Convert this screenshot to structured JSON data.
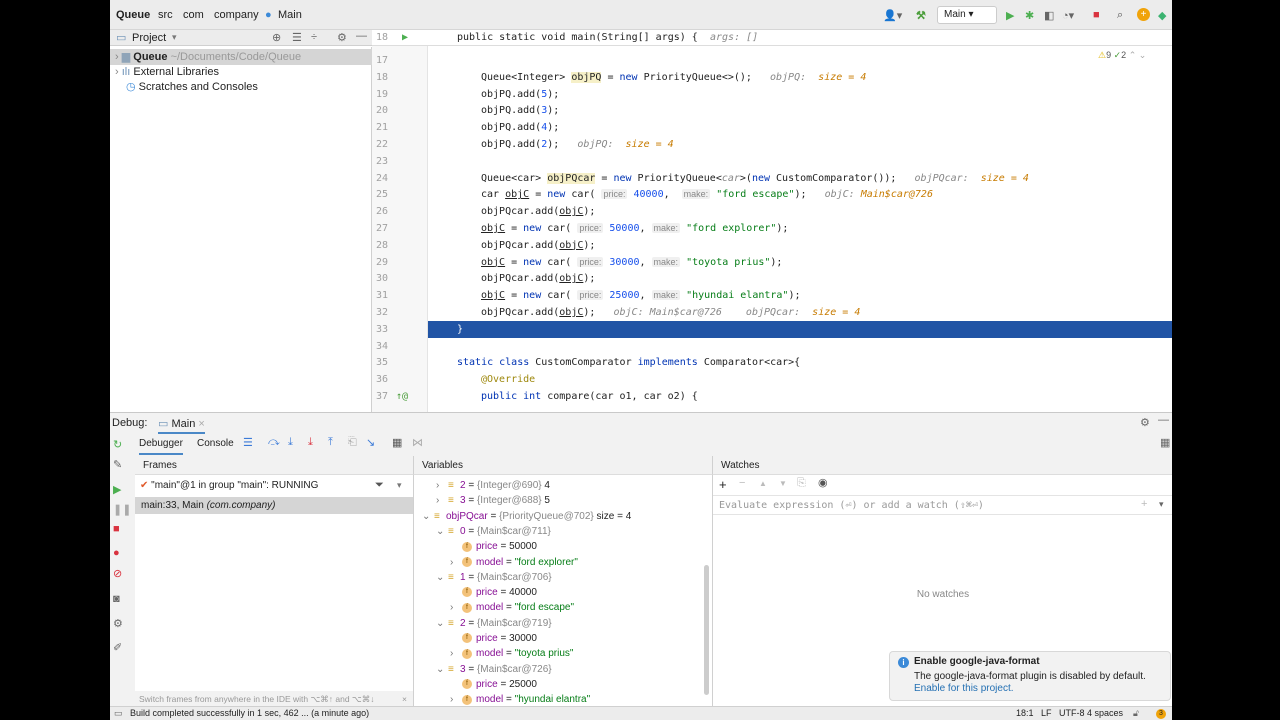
{
  "breadcrumb": [
    "Queue",
    "src",
    "com",
    "company",
    "Main"
  ],
  "nav": {
    "run_config": "Main"
  },
  "project": {
    "label": "Project",
    "items": [
      {
        "name": "Queue",
        "path": "~/Documents/Code/Queue"
      },
      {
        "name": "External Libraries"
      },
      {
        "name": "Scratches and Consoles"
      }
    ]
  },
  "editor": {
    "sticky": {
      "n": "18",
      "text": "public static void main(String[] args) {",
      "hint": "args: []"
    },
    "warnings": "9",
    "weak_warnings": "2",
    "lines": [
      {
        "n": "17",
        "i": 0,
        "t": []
      },
      {
        "n": "18",
        "i": 2,
        "t": [
          [
            "Queue<Integer> ",
            ""
          ],
          [
            "objPQ",
            "hl"
          ],
          [
            " = ",
            ""
          ],
          [
            "new",
            "kw"
          ],
          [
            " PriorityQueue<>();   ",
            ""
          ],
          [
            "objPQ:  ",
            "hint"
          ],
          [
            "size = 4",
            "hintv"
          ]
        ]
      },
      {
        "n": "19",
        "i": 2,
        "t": [
          [
            "objPQ.add(",
            ""
          ],
          [
            "5",
            "num"
          ],
          [
            ");",
            ""
          ]
        ]
      },
      {
        "n": "20",
        "i": 2,
        "t": [
          [
            "objPQ.add(",
            ""
          ],
          [
            "3",
            "num"
          ],
          [
            ");",
            ""
          ]
        ]
      },
      {
        "n": "21",
        "i": 2,
        "t": [
          [
            "objPQ.add(",
            ""
          ],
          [
            "4",
            "num"
          ],
          [
            ");",
            ""
          ]
        ]
      },
      {
        "n": "22",
        "i": 2,
        "t": [
          [
            "objPQ.add(",
            ""
          ],
          [
            "2",
            "num"
          ],
          [
            ");   ",
            ""
          ],
          [
            "objPQ:  ",
            "hint"
          ],
          [
            "size = 4",
            "hintv"
          ]
        ]
      },
      {
        "n": "23",
        "i": 0,
        "t": []
      },
      {
        "n": "24",
        "i": 2,
        "t": [
          [
            "Queue<car> ",
            ""
          ],
          [
            "objPQcar",
            "hl"
          ],
          [
            " = ",
            ""
          ],
          [
            "new",
            "kw"
          ],
          [
            " PriorityQueue<",
            ""
          ],
          [
            "car",
            "hint"
          ],
          [
            ">(",
            ""
          ],
          [
            "new",
            "kw"
          ],
          [
            " CustomComparator());   ",
            ""
          ],
          [
            "objPQcar:  ",
            "hint"
          ],
          [
            "size = 4",
            "hintv"
          ]
        ]
      },
      {
        "n": "25",
        "i": 2,
        "t": [
          [
            "car ",
            ""
          ],
          [
            "objC",
            "ul"
          ],
          [
            " = ",
            ""
          ],
          [
            "new",
            "kw"
          ],
          [
            " car( ",
            ""
          ],
          [
            "price:",
            "param"
          ],
          [
            " ",
            ""
          ],
          [
            "40000",
            "num"
          ],
          [
            ",  ",
            ""
          ],
          [
            "make:",
            "param"
          ],
          [
            " ",
            ""
          ],
          [
            "\"ford escape\"",
            "str"
          ],
          [
            ");   ",
            ""
          ],
          [
            "objC: ",
            "hint"
          ],
          [
            "Main$car@726",
            "hintv"
          ]
        ]
      },
      {
        "n": "26",
        "i": 2,
        "t": [
          [
            "objPQcar.add(",
            ""
          ],
          [
            "objC",
            "ul"
          ],
          [
            ");",
            ""
          ]
        ]
      },
      {
        "n": "27",
        "i": 2,
        "t": [
          [
            "objC",
            "ul"
          ],
          [
            " = ",
            ""
          ],
          [
            "new",
            "kw"
          ],
          [
            " car( ",
            ""
          ],
          [
            "price:",
            "param"
          ],
          [
            " ",
            ""
          ],
          [
            "50000",
            "num"
          ],
          [
            ", ",
            ""
          ],
          [
            "make:",
            "param"
          ],
          [
            " ",
            ""
          ],
          [
            "\"ford explorer\"",
            "str"
          ],
          [
            ");",
            ""
          ]
        ]
      },
      {
        "n": "28",
        "i": 2,
        "t": [
          [
            "objPQcar.add(",
            ""
          ],
          [
            "objC",
            "ul"
          ],
          [
            ");",
            ""
          ]
        ]
      },
      {
        "n": "29",
        "i": 2,
        "t": [
          [
            "objC",
            "ul"
          ],
          [
            " = ",
            ""
          ],
          [
            "new",
            "kw"
          ],
          [
            " car( ",
            ""
          ],
          [
            "price:",
            "param"
          ],
          [
            " ",
            ""
          ],
          [
            "30000",
            "num"
          ],
          [
            ", ",
            ""
          ],
          [
            "make:",
            "param"
          ],
          [
            " ",
            ""
          ],
          [
            "\"toyota prius\"",
            "str"
          ],
          [
            ");",
            ""
          ]
        ]
      },
      {
        "n": "30",
        "i": 2,
        "t": [
          [
            "objPQcar.add(",
            ""
          ],
          [
            "objC",
            "ul"
          ],
          [
            ");",
            ""
          ]
        ]
      },
      {
        "n": "31",
        "i": 2,
        "t": [
          [
            "objC",
            "ul"
          ],
          [
            " = ",
            ""
          ],
          [
            "new",
            "kw"
          ],
          [
            " car( ",
            ""
          ],
          [
            "price:",
            "param"
          ],
          [
            " ",
            ""
          ],
          [
            "25000",
            "num"
          ],
          [
            ", ",
            ""
          ],
          [
            "make:",
            "param"
          ],
          [
            " ",
            ""
          ],
          [
            "\"hyundai elantra\"",
            "str"
          ],
          [
            ");",
            ""
          ]
        ]
      },
      {
        "n": "32",
        "i": 2,
        "t": [
          [
            "objPQcar.add(",
            ""
          ],
          [
            "objC",
            "ul"
          ],
          [
            ");   ",
            ""
          ],
          [
            "objC: Main$car@726    objPQcar:  ",
            "hint"
          ],
          [
            "size = 4",
            "hintv"
          ]
        ]
      },
      {
        "n": "33",
        "i": 1,
        "t": [
          [
            "}",
            ""
          ]
        ],
        "current": true
      },
      {
        "n": "34",
        "i": 0,
        "t": []
      },
      {
        "n": "35",
        "i": 1,
        "t": [
          [
            "static class",
            "kw"
          ],
          [
            " CustomComparator ",
            ""
          ],
          [
            "implements",
            "kw"
          ],
          [
            " Comparator<car>{",
            ""
          ]
        ]
      },
      {
        "n": "36",
        "i": 2,
        "t": [
          [
            "@Override",
            "ann"
          ]
        ]
      },
      {
        "n": "37",
        "i": 2,
        "t": [
          [
            "public int",
            "kw"
          ],
          [
            " compare(car o1, car o2) {",
            ""
          ]
        ]
      }
    ]
  },
  "debug": {
    "label": "Debug:",
    "session": "Main",
    "tabs": [
      "Debugger",
      "Console"
    ],
    "frames": {
      "title": "Frames",
      "thread": "\"main\"@1 in group \"main\": RUNNING",
      "frame": "main:33, Main",
      "frame_pkg": "(com.company)",
      "tip": "Switch frames from anywhere in the IDE with ⌥⌘↑ and ⌥⌘↓"
    },
    "variables": {
      "title": "Variables",
      "rows": [
        {
          "d": 1,
          "e": ">",
          "k": "list",
          "n": "2",
          "v": "{Integer@690}",
          "x": "4"
        },
        {
          "d": 1,
          "e": ">",
          "k": "list",
          "n": "3",
          "v": "{Integer@688}",
          "x": "5"
        },
        {
          "d": 0,
          "e": "v",
          "k": "list",
          "n": "objPQcar",
          "v": "{PriorityQueue@702}",
          "x": " size = 4"
        },
        {
          "d": 1,
          "e": "v",
          "k": "list",
          "n": "0",
          "v": "{Main$car@711}",
          "x": ""
        },
        {
          "d": 2,
          "e": "",
          "k": "f",
          "n": "price",
          "v": "",
          "x": "50000"
        },
        {
          "d": 2,
          "e": ">",
          "k": "f",
          "n": "model",
          "v": "",
          "x": "\"ford explorer\"",
          "s": true
        },
        {
          "d": 1,
          "e": "v",
          "k": "list",
          "n": "1",
          "v": "{Main$car@706}",
          "x": ""
        },
        {
          "d": 2,
          "e": "",
          "k": "f",
          "n": "price",
          "v": "",
          "x": "40000"
        },
        {
          "d": 2,
          "e": ">",
          "k": "f",
          "n": "model",
          "v": "",
          "x": "\"ford escape\"",
          "s": true
        },
        {
          "d": 1,
          "e": "v",
          "k": "list",
          "n": "2",
          "v": "{Main$car@719}",
          "x": ""
        },
        {
          "d": 2,
          "e": "",
          "k": "f",
          "n": "price",
          "v": "",
          "x": "30000"
        },
        {
          "d": 2,
          "e": ">",
          "k": "f",
          "n": "model",
          "v": "",
          "x": "\"toyota prius\"",
          "s": true
        },
        {
          "d": 1,
          "e": "v",
          "k": "list",
          "n": "3",
          "v": "{Main$car@726}",
          "x": ""
        },
        {
          "d": 2,
          "e": "",
          "k": "f",
          "n": "price",
          "v": "",
          "x": "25000"
        },
        {
          "d": 2,
          "e": ">",
          "k": "f",
          "n": "model",
          "v": "",
          "x": "\"hyundai elantra\"",
          "s": true
        }
      ]
    },
    "watches": {
      "title": "Watches",
      "placeholder": "Evaluate expression (⏎) or add a watch (⇧⌘⏎)",
      "empty": "No watches"
    }
  },
  "notification": {
    "title": "Enable google-java-format",
    "body": "The google-java-format plugin is disabled by default.",
    "link": "Enable for this project."
  },
  "status": {
    "message": "Build completed successfully in 1 sec, 462 ... (a minute ago)",
    "position": "18:1",
    "line_sep": "LF",
    "encoding": "UTF-8",
    "indent": "4 spaces",
    "events": "3"
  }
}
